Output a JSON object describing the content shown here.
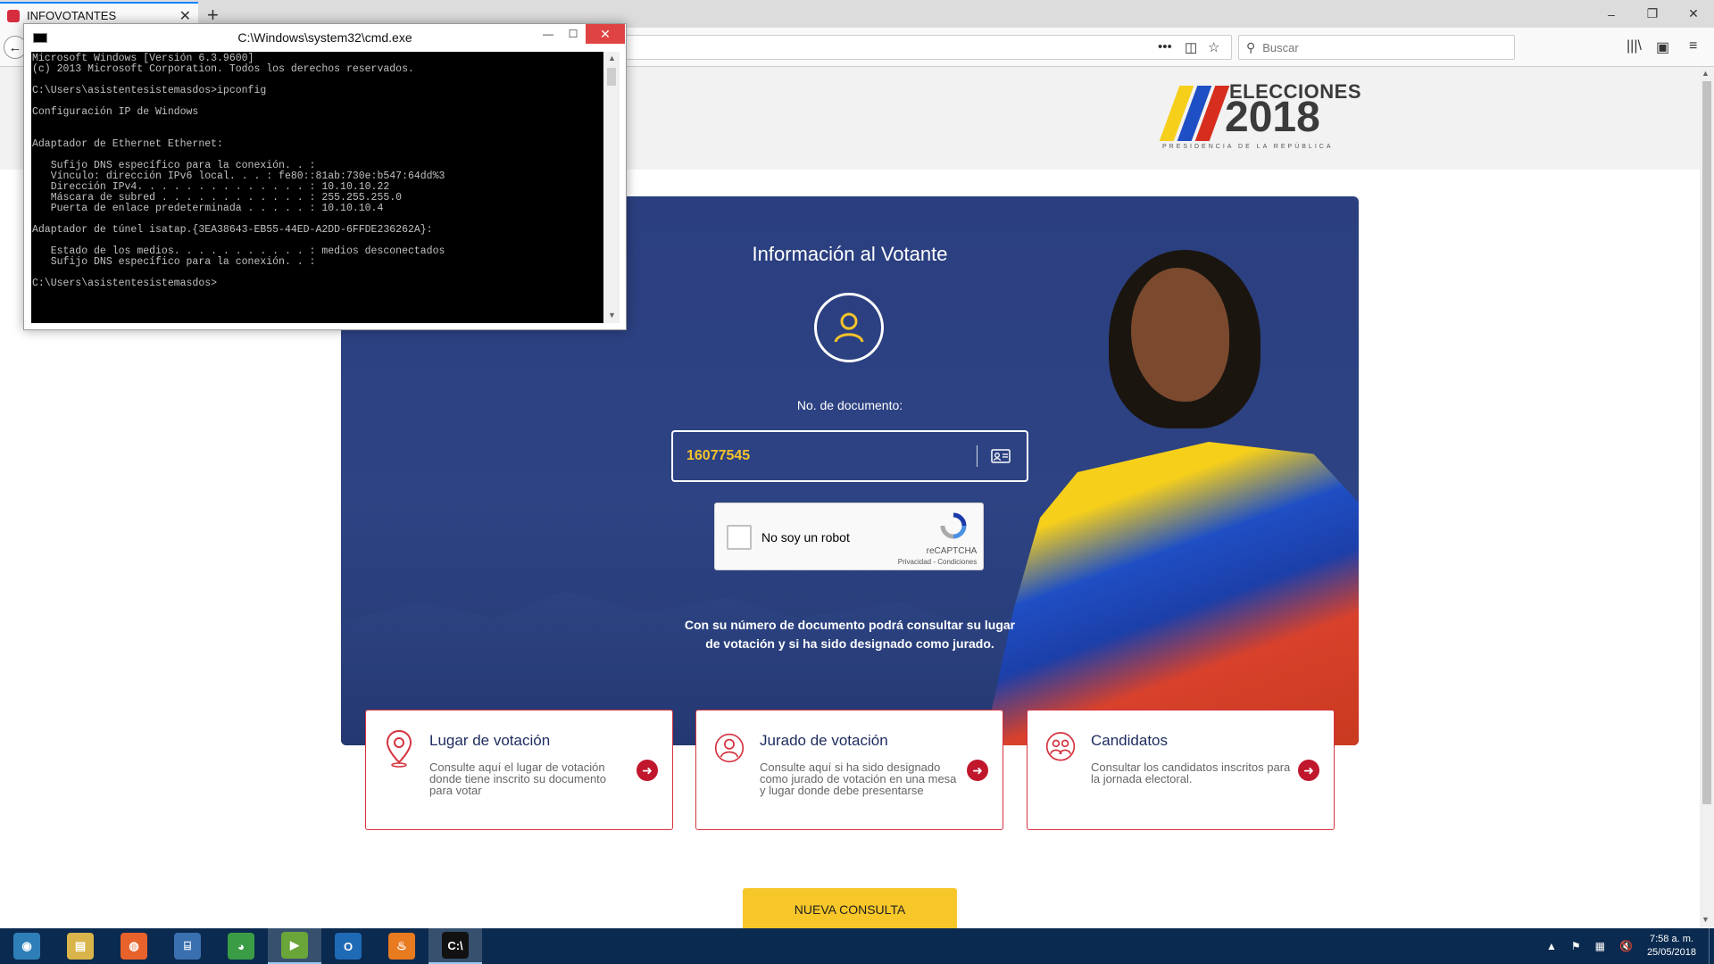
{
  "browser": {
    "tab_title": "INFOVOTANTES",
    "tab_close": "✕",
    "new_tab": "+",
    "window_controls": {
      "minimize": "–",
      "restore": "❐",
      "close": "✕"
    },
    "nav": {
      "back": "←",
      "page_actions": "•••",
      "pocket": "◫",
      "bookmark": "☆"
    },
    "search_placeholder": "Buscar",
    "search_icon": "⚲",
    "toolbar_icons": {
      "library": "|||\\",
      "sidebar": "▣",
      "menu": "≡"
    }
  },
  "logo": {
    "line1": "ELECCIONES",
    "line2": "2018",
    "line3": "PRESIDENCIA DE LA REPÚBLICA",
    "stripe_colors": [
      "#f6cf1b",
      "#1f4fc4",
      "#d62d1e"
    ]
  },
  "hero": {
    "title": "Información al Votante",
    "doc_label": "No. de documento:",
    "doc_value": "16077545",
    "captcha_label": "No soy un robot",
    "captcha_brand": "reCAPTCHA",
    "captcha_links": "Privacidad - Condiciones",
    "info_text": "Con su número de documento podrá consultar su lugar de votación y si ha sido designado como jurado."
  },
  "cards": [
    {
      "title": "Lugar de votación",
      "desc": "Consulte aquí el lugar de votación donde tiene inscrito su documento para votar",
      "icon": "location-pin-icon"
    },
    {
      "title": "Jurado de votación",
      "desc": "Consulte aquí si ha sido designado como jurado de votación en una mesa y lugar donde debe presentarse",
      "icon": "person-icon"
    },
    {
      "title": "Candidatos",
      "desc": "Consultar los candidatos inscritos para la jornada electoral.",
      "icon": "people-icon"
    }
  ],
  "card_arrow": "➜",
  "nueva_consulta": "NUEVA CONSULTA",
  "cmd": {
    "title": "C:\\Windows\\system32\\cmd.exe",
    "controls": {
      "minimize": "—",
      "maximize": "☐",
      "close": "✕"
    },
    "output": "Microsoft Windows [Versión 6.3.9600]\n(c) 2013 Microsoft Corporation. Todos los derechos reservados.\n\nC:\\Users\\asistentesistemasdos>ipconfig\n\nConfiguración IP de Windows\n\n\nAdaptador de Ethernet Ethernet:\n\n   Sufijo DNS específico para la conexión. . :\n   Vínculo: dirección IPv6 local. . . : fe80::81ab:730e:b547:64dd%3\n   Dirección IPv4. . . . . . . . . . . . . . : 10.10.10.22\n   Máscara de subred . . . . . . . . . . . . : 255.255.255.0\n   Puerta de enlace predeterminada . . . . . : 10.10.10.4\n\nAdaptador de túnel isatap.{3EA38643-EB55-44ED-A2DD-6FFDE236262A}:\n\n   Estado de los medios. . . . . . . . . . . : medios desconectados\n   Sufijo DNS específico para la conexión. . :\n\nC:\\Users\\asistentesistemasdos>"
  },
  "taskbar": {
    "apps": [
      {
        "name": "start",
        "glyph": "◉",
        "color": "#2e7fb8"
      },
      {
        "name": "file-explorer",
        "glyph": "▤",
        "color": "#d9b44a"
      },
      {
        "name": "firefox",
        "glyph": "◍",
        "color": "#e8632b"
      },
      {
        "name": "remote-desktop",
        "glyph": "⌸",
        "color": "#3a6fb0"
      },
      {
        "name": "chrome",
        "glyph": "◕",
        "color": "#3a9d46"
      },
      {
        "name": "media-player",
        "glyph": "▶",
        "color": "#6aa53a"
      },
      {
        "name": "outlook",
        "glyph": "O",
        "color": "#1f6ab5"
      },
      {
        "name": "flame-app",
        "glyph": "♨",
        "color": "#e87a1f"
      },
      {
        "name": "cmd",
        "glyph": "C:\\",
        "color": "#111111"
      }
    ],
    "tray": {
      "chevron": "▲",
      "flag": "⚑",
      "network": "▦",
      "volume": "🔇"
    },
    "time": "7:58 a. m.",
    "date": "25/05/2018"
  }
}
